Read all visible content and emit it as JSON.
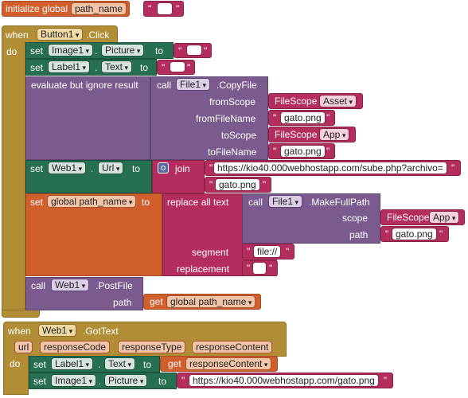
{
  "global_decl": {
    "initialize_label": "initialize global",
    "name": "path_name",
    "to_label": "to",
    "value": ""
  },
  "button_click": {
    "when": "when",
    "component": "Button1",
    "event": ".Click",
    "do": "do",
    "set1": {
      "set": "set",
      "component": "Image1",
      "dot": ".",
      "property": "Picture",
      "to": "to",
      "value": ""
    },
    "set2": {
      "set": "set",
      "component": "Label1",
      "dot": ".",
      "property": "Text",
      "to": "to",
      "value": ""
    },
    "evaluate": {
      "label": "evaluate but ignore result",
      "call": "call",
      "component": "File1",
      "method": ".CopyFile",
      "fromScope_label": "fromScope",
      "fromScope_value": "FileScope",
      "fromScope_option": "Asset",
      "fromFileName_label": "fromFileName",
      "fromFileName_value": "gato.png",
      "toScope_label": "toScope",
      "toScope_value": "FileScope",
      "toScope_option": "App",
      "toFileName_label": "toFileName",
      "toFileName_value": "gato.png"
    },
    "set_url": {
      "set": "set",
      "component": "Web1",
      "dot": ".",
      "property": "Url",
      "to": "to",
      "join": "join",
      "part1": "https://kio40.000webhostapp.com/sube.php?archivo=",
      "part2": "gato.png"
    },
    "set_global": {
      "set": "set",
      "name": "global path_name",
      "to": "to",
      "replace": "replace all text",
      "call": "call",
      "component": "File1",
      "method": ".MakeFullPath",
      "scope_label": "scope",
      "scope_value": "FileScope",
      "scope_option": "App",
      "path_label": "path",
      "path_value": "gato.png",
      "segment_label": "segment",
      "segment_value": "file://",
      "replacement_label": "replacement",
      "replacement_value": ""
    },
    "postfile": {
      "call": "call",
      "component": "Web1",
      "method": ".PostFile",
      "path_label": "path",
      "get": "get",
      "get_name": "global path_name"
    }
  },
  "web_gottext": {
    "when": "when",
    "component": "Web1",
    "event": ".GotText",
    "params": [
      "url",
      "responseCode",
      "responseType",
      "responseContent"
    ],
    "do": "do",
    "set1": {
      "set": "set",
      "component": "Label1",
      "dot": ".",
      "property": "Text",
      "to": "to",
      "get": "get",
      "get_name": "responseContent"
    },
    "set2": {
      "set": "set",
      "component": "Image1",
      "dot": ".",
      "property": "Picture",
      "to": "to",
      "value": "https://kio40.000webhostapp.com/gato.png"
    }
  }
}
